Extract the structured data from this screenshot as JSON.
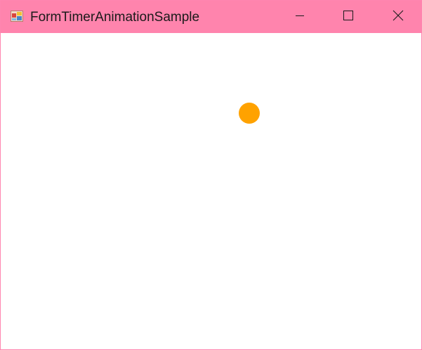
{
  "window": {
    "title": "FormTimerAnimationSample",
    "app_icon": "winforms-app-icon",
    "controls": {
      "minimize_icon": "minimize-icon",
      "maximize_icon": "maximize-icon",
      "close_icon": "close-icon"
    }
  },
  "colors": {
    "titlebar": "#ff84ad",
    "border": "#ff86b0",
    "ball": "#ffa200",
    "client_background": "#ffffff"
  },
  "canvas": {
    "ball_shape": "circle"
  }
}
